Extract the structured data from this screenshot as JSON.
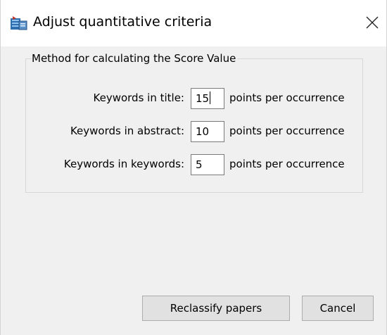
{
  "window": {
    "title": "Adjust quantitative criteria",
    "app_icon": "database-icon",
    "close_icon": "close-icon"
  },
  "group": {
    "legend": "Method for calculating the Score Value",
    "rows": [
      {
        "label": "Keywords in title:",
        "value": "15",
        "suffix": "points per occurrence"
      },
      {
        "label": "Keywords in abstract:",
        "value": "10",
        "suffix": "points per occurrence"
      },
      {
        "label": "Keywords in keywords:",
        "value": "5",
        "suffix": "points per occurrence"
      }
    ]
  },
  "buttons": {
    "reclassify": "Reclassify papers",
    "cancel": "Cancel"
  },
  "colors": {
    "dialog_background": "#f0f0f0",
    "titlebar_background": "#ffffff",
    "button_background": "#e1e1e1",
    "icon_blue": "#2f6fb0",
    "icon_red": "#c0392b"
  }
}
